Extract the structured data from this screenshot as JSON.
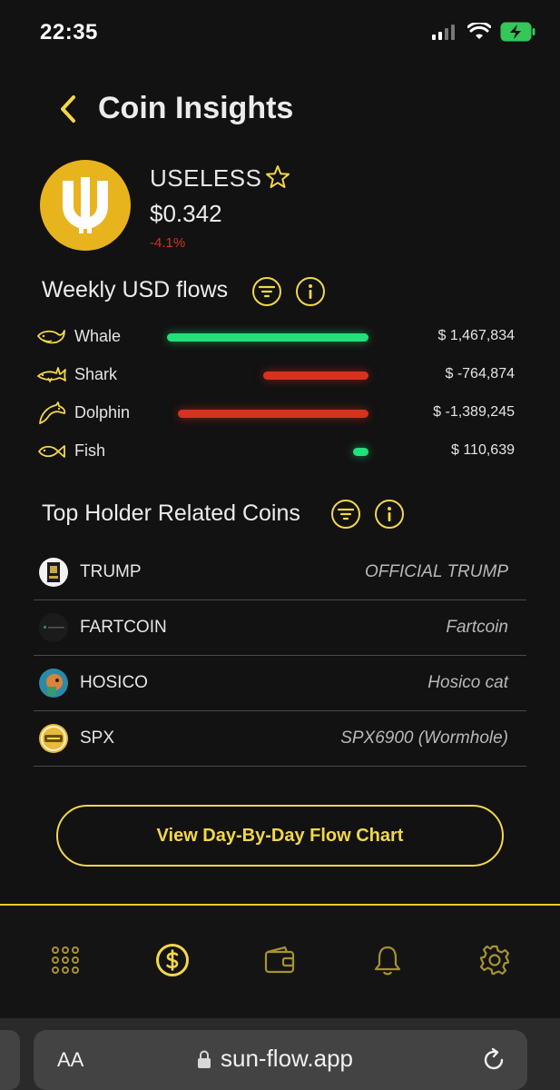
{
  "status": {
    "time": "22:35"
  },
  "header": {
    "title": "Coin Insights"
  },
  "coin": {
    "ticker": "USELESS",
    "price": "$0.342",
    "change": "-4.1%"
  },
  "flows": {
    "title": "Weekly USD flows",
    "rows": [
      {
        "label": "Whale",
        "value": "$ 1,467,834",
        "amount": 1467834,
        "icon": "whale-icon"
      },
      {
        "label": "Shark",
        "value": "$ -764,874",
        "amount": -764874,
        "icon": "shark-icon"
      },
      {
        "label": "Dolphin",
        "value": "$ -1,389,245",
        "amount": -1389245,
        "icon": "dolphin-icon"
      },
      {
        "label": "Fish",
        "value": "$ 110,639",
        "amount": 110639,
        "icon": "fish-icon"
      }
    ]
  },
  "related": {
    "title": "Top Holder Related Coins",
    "coins": [
      {
        "symbol": "TRUMP",
        "name": "OFFICIAL TRUMP"
      },
      {
        "symbol": "FARTCOIN",
        "name": "Fartcoin"
      },
      {
        "symbol": "HOSICO",
        "name": "Hosico cat"
      },
      {
        "symbol": "SPX",
        "name": "SPX6900 (Wormhole)"
      }
    ]
  },
  "cta": {
    "label": "View Day-By-Day Flow Chart"
  },
  "tabs": [
    "grid-icon",
    "dollar-icon",
    "wallet-icon",
    "bell-icon",
    "gear-icon"
  ],
  "browser": {
    "aa": "AA",
    "url": "sun-flow.app"
  },
  "colors": {
    "accent": "#f3d74a",
    "positive": "#22e07a",
    "negative": "#d8321f",
    "coin": "#e8b41e"
  }
}
